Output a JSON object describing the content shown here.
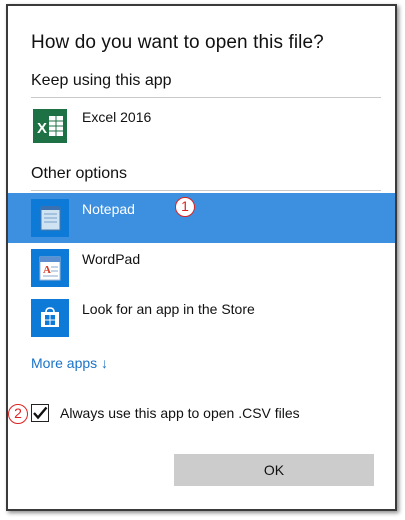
{
  "dialog": {
    "title": "How do you want to open this file?",
    "keep_using_label": "Keep using this app",
    "current_app": {
      "name": "Excel 2016",
      "icon": "excel-icon"
    },
    "other_options_label": "Other options",
    "apps": [
      {
        "name": "Notepad",
        "icon": "notepad-icon",
        "selected": true
      },
      {
        "name": "WordPad",
        "icon": "wordpad-icon",
        "selected": false
      },
      {
        "name": "Look for an app in the Store",
        "icon": "store-icon",
        "selected": false
      }
    ],
    "more_apps_label": "More apps ↓",
    "always_use_label": "Always use this app to open .CSV files",
    "always_use_checked": true,
    "ok_label": "OK"
  },
  "annotations": {
    "marker1": "1",
    "marker2": "2"
  },
  "colors": {
    "selection": "#3d8fe0",
    "link": "#1a73c7",
    "accent": "#0e7ad7",
    "marker": "#dd2222"
  }
}
